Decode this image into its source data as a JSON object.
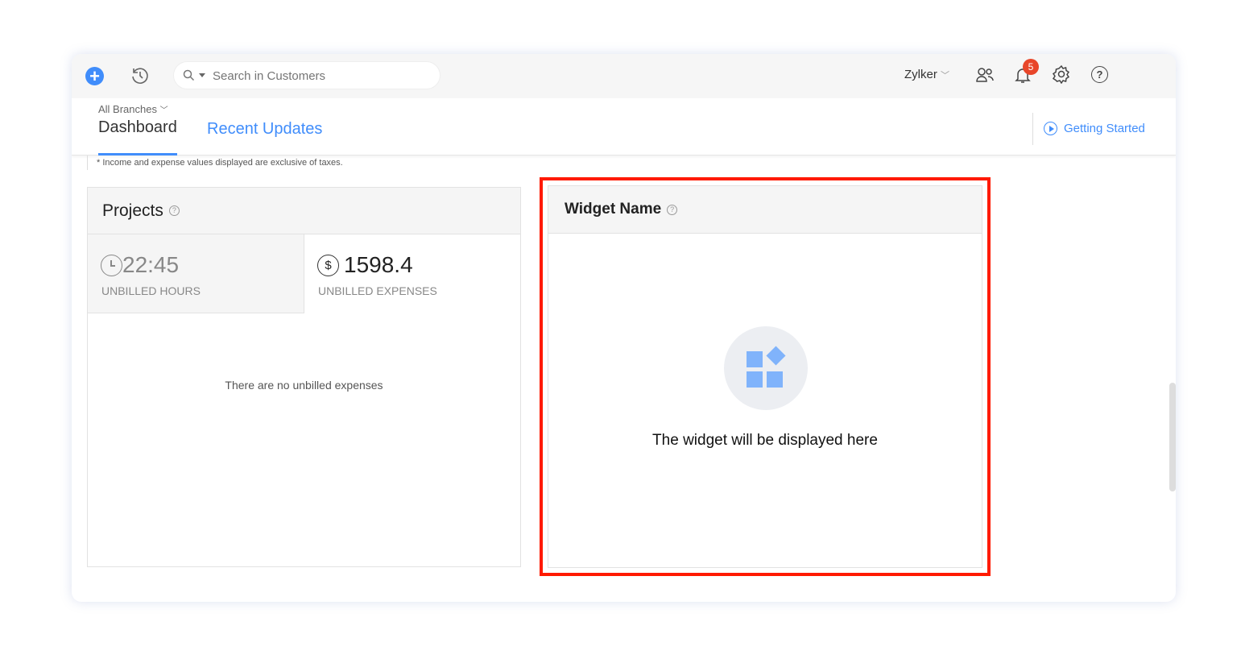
{
  "topbar": {
    "search_placeholder": "Search in Customers",
    "org": "Zylker",
    "notification_count": "5"
  },
  "nav": {
    "branch": "All Branches",
    "tabs": [
      {
        "label": "Dashboard",
        "active": true
      },
      {
        "label": "Recent Updates",
        "active": false
      }
    ],
    "getting_started": "Getting Started"
  },
  "note": "* Income and expense values displayed are exclusive of taxes.",
  "projects": {
    "title": "Projects",
    "hours": {
      "value": "22:45",
      "label": "UNBILLED HOURS"
    },
    "expenses": {
      "value": "1598.4",
      "label": "UNBILLED EXPENSES"
    },
    "empty": "There are no unbilled expenses"
  },
  "widget": {
    "title": "Widget Name",
    "placeholder": "The widget will be displayed here"
  },
  "colors": {
    "accent": "#408dfb",
    "highlight": "#ff1a00",
    "badge": "#e8462a"
  }
}
